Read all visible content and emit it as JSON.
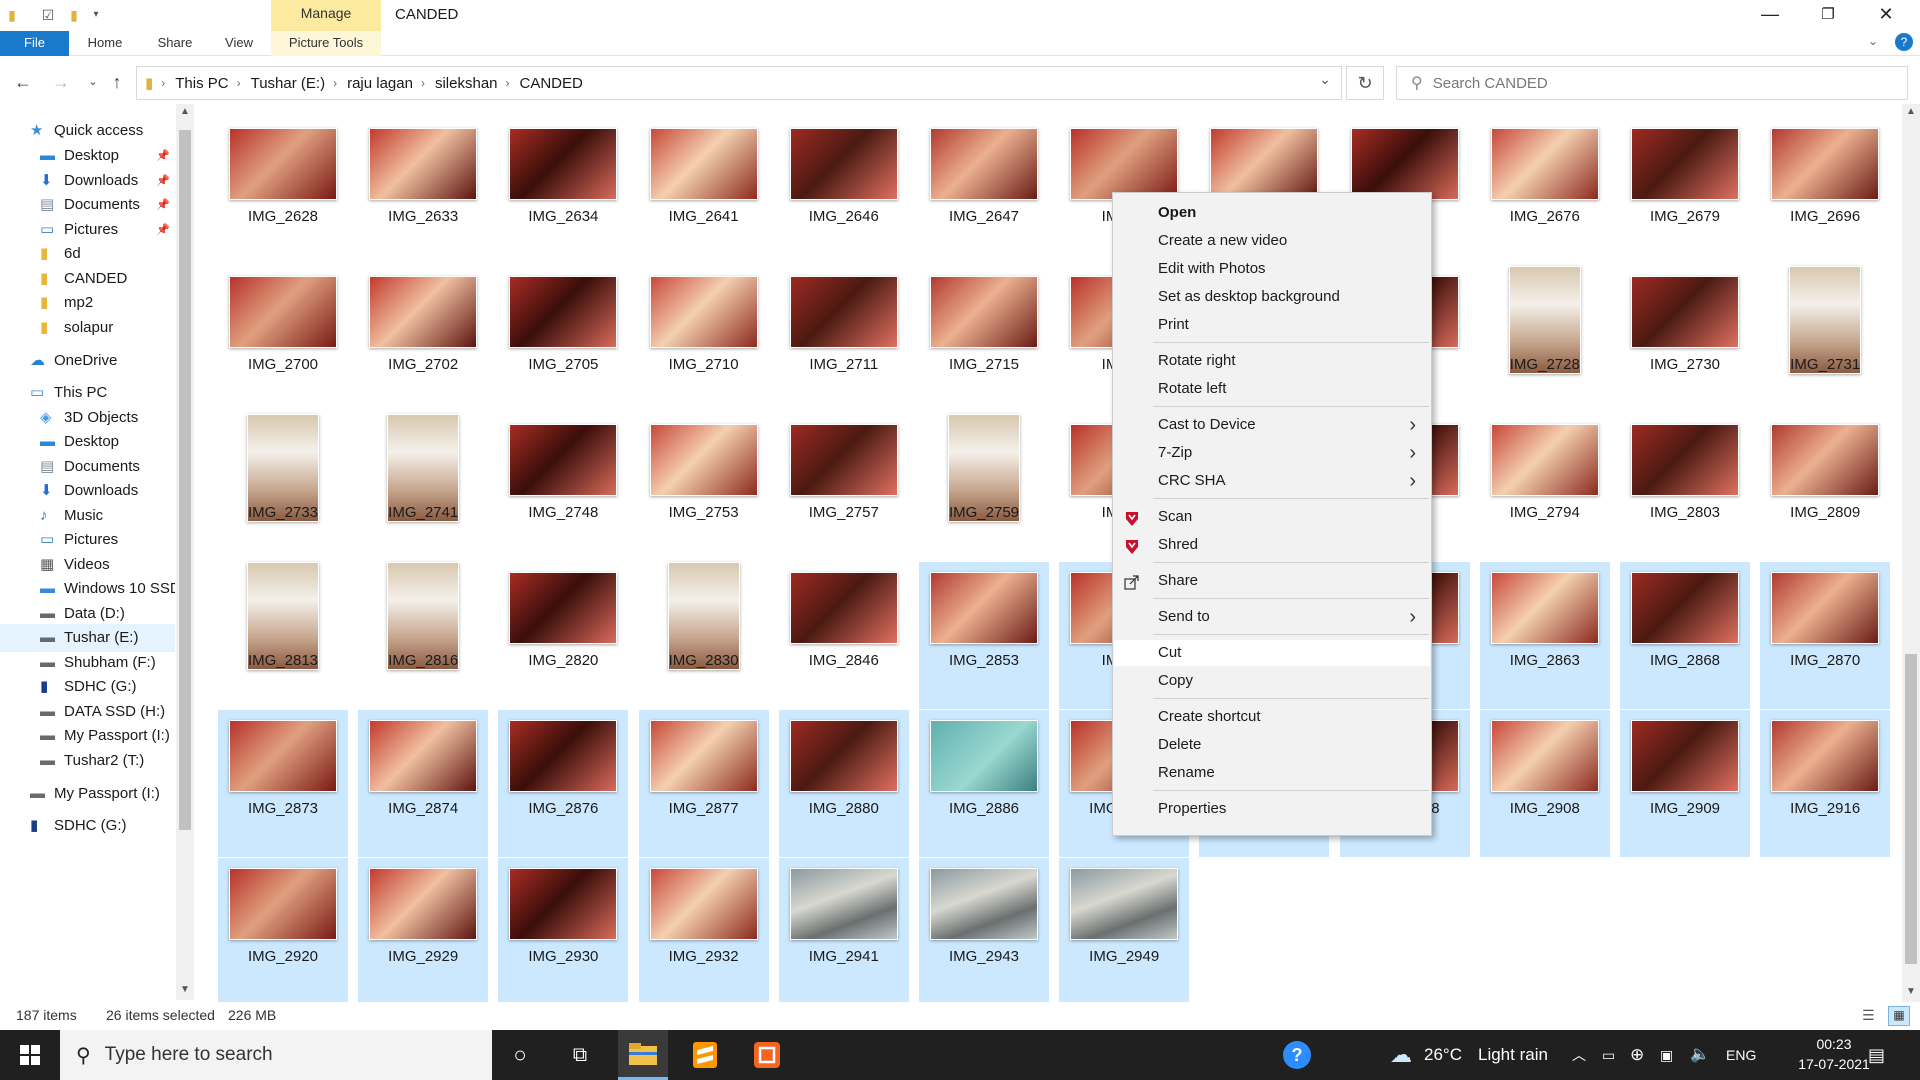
{
  "window": {
    "title": "CANDED",
    "manage_tab": "Manage",
    "colors": {
      "accent": "#1979ca",
      "selection": "#cce8ff",
      "manage_tab": "#fbeaa0",
      "taskbar": "#202020"
    }
  },
  "ribbon": {
    "tabs": [
      "File",
      "Home",
      "Share",
      "View",
      "Picture Tools"
    ]
  },
  "address": {
    "crumbs": [
      "This PC",
      "Tushar (E:)",
      "raju lagan",
      "silekshan",
      "CANDED"
    ],
    "search_placeholder": "Search CANDED"
  },
  "nav": {
    "items": [
      {
        "label": "Quick access",
        "icon": "star-icon",
        "indent": 0
      },
      {
        "label": "Desktop",
        "icon": "desktop-icon",
        "indent": 1,
        "pinned": true
      },
      {
        "label": "Downloads",
        "icon": "download-icon",
        "indent": 1,
        "pinned": true
      },
      {
        "label": "Documents",
        "icon": "documents-icon",
        "indent": 1,
        "pinned": true
      },
      {
        "label": "Pictures",
        "icon": "pictures-icon",
        "indent": 1,
        "pinned": true
      },
      {
        "label": "6d",
        "icon": "folder-icon",
        "indent": 1
      },
      {
        "label": "CANDED",
        "icon": "folder-icon",
        "indent": 1
      },
      {
        "label": "mp2",
        "icon": "folder-icon",
        "indent": 1
      },
      {
        "label": "solapur",
        "icon": "folder-icon",
        "indent": 1
      },
      {
        "label": "OneDrive",
        "icon": "cloud-icon",
        "indent": 0
      },
      {
        "label": "This PC",
        "icon": "pc-icon",
        "indent": 0
      },
      {
        "label": "3D Objects",
        "icon": "cube-icon",
        "indent": 1
      },
      {
        "label": "Desktop",
        "icon": "desktop-icon",
        "indent": 1
      },
      {
        "label": "Documents",
        "icon": "documents-icon",
        "indent": 1
      },
      {
        "label": "Downloads",
        "icon": "download-icon",
        "indent": 1
      },
      {
        "label": "Music",
        "icon": "music-icon",
        "indent": 1
      },
      {
        "label": "Pictures",
        "icon": "pictures-icon",
        "indent": 1
      },
      {
        "label": "Videos",
        "icon": "videos-icon",
        "indent": 1
      },
      {
        "label": "Windows 10 SSD",
        "icon": "windows-drive-icon",
        "indent": 1
      },
      {
        "label": "Data (D:)",
        "icon": "drive-icon",
        "indent": 1
      },
      {
        "label": "Tushar (E:)",
        "icon": "drive-icon",
        "indent": 1,
        "selected": true
      },
      {
        "label": "Shubham (F:)",
        "icon": "drive-icon",
        "indent": 1
      },
      {
        "label": "SDHC (G:)",
        "icon": "sd-card-icon",
        "indent": 1
      },
      {
        "label": "DATA SSD (H:)",
        "icon": "drive-icon",
        "indent": 1
      },
      {
        "label": "My Passport (I:)",
        "icon": "drive-icon",
        "indent": 1
      },
      {
        "label": "Tushar2 (T:)",
        "icon": "drive-icon",
        "indent": 1
      },
      {
        "label": "My Passport (I:)",
        "icon": "drive-icon",
        "indent": 0
      },
      {
        "label": "SDHC (G:)",
        "icon": "sd-card-icon",
        "indent": 0
      }
    ]
  },
  "files": [
    {
      "name": "IMG_2628"
    },
    {
      "name": "IMG_2633"
    },
    {
      "name": "IMG_2634"
    },
    {
      "name": "IMG_2641"
    },
    {
      "name": "IMG_2646"
    },
    {
      "name": "IMG_2647"
    },
    {
      "name": "IMG_2"
    },
    {
      "name": ""
    },
    {
      "name": "5"
    },
    {
      "name": "IMG_2676"
    },
    {
      "name": "IMG_2679"
    },
    {
      "name": "IMG_2696"
    },
    {
      "name": "IMG_2700"
    },
    {
      "name": "IMG_2702"
    },
    {
      "name": "IMG_2705"
    },
    {
      "name": "IMG_2710"
    },
    {
      "name": "IMG_2711"
    },
    {
      "name": "IMG_2715"
    },
    {
      "name": "IMG_2"
    },
    {
      "name": ""
    },
    {
      "name": "5"
    },
    {
      "name": "IMG_2728",
      "portrait": true
    },
    {
      "name": "IMG_2730"
    },
    {
      "name": "IMG_2731",
      "portrait": true
    },
    {
      "name": "IMG_2733",
      "portrait": true
    },
    {
      "name": "IMG_2741",
      "portrait": true
    },
    {
      "name": "IMG_2748"
    },
    {
      "name": "IMG_2753"
    },
    {
      "name": "IMG_2757"
    },
    {
      "name": "IMG_2759",
      "portrait": true
    },
    {
      "name": "IMG_2"
    },
    {
      "name": ""
    },
    {
      "name": "3"
    },
    {
      "name": "IMG_2794"
    },
    {
      "name": "IMG_2803"
    },
    {
      "name": "IMG_2809"
    },
    {
      "name": "IMG_2813",
      "portrait": true
    },
    {
      "name": "IMG_2816",
      "portrait": true
    },
    {
      "name": "IMG_2820"
    },
    {
      "name": "IMG_2830",
      "portrait": true
    },
    {
      "name": "IMG_2846"
    },
    {
      "name": "IMG_2853",
      "selected": true
    },
    {
      "name": "IMG_2",
      "selected": true
    },
    {
      "name": "",
      "selected": true
    },
    {
      "name": "1",
      "selected": true
    },
    {
      "name": "IMG_2863",
      "selected": true
    },
    {
      "name": "IMG_2868",
      "selected": true
    },
    {
      "name": "IMG_2870",
      "selected": true
    },
    {
      "name": "IMG_2873",
      "selected": true
    },
    {
      "name": "IMG_2874",
      "selected": true
    },
    {
      "name": "IMG_2876",
      "selected": true
    },
    {
      "name": "IMG_2877",
      "selected": true
    },
    {
      "name": "IMG_2880",
      "selected": true
    },
    {
      "name": "IMG_2886",
      "selected": true
    },
    {
      "name": "IMG_2892",
      "selected": true
    },
    {
      "name": "IMG_2895",
      "selected": true
    },
    {
      "name": "IMG_2898",
      "selected": true
    },
    {
      "name": "IMG_2908",
      "selected": true
    },
    {
      "name": "IMG_2909",
      "selected": true
    },
    {
      "name": "IMG_2916",
      "selected": true
    },
    {
      "name": "IMG_2920",
      "selected": true
    },
    {
      "name": "IMG_2929",
      "selected": true
    },
    {
      "name": "IMG_2930",
      "selected": true
    },
    {
      "name": "IMG_2932",
      "selected": true
    },
    {
      "name": "IMG_2941",
      "selected": true
    },
    {
      "name": "IMG_2943",
      "selected": true
    },
    {
      "name": "IMG_2949",
      "selected": true
    }
  ],
  "context_menu": {
    "items": [
      {
        "label": "Open",
        "bold": true
      },
      {
        "label": "Create a new video"
      },
      {
        "label": "Edit with Photos"
      },
      {
        "label": "Set as desktop background"
      },
      {
        "label": "Print"
      },
      {
        "sep": true
      },
      {
        "label": "Rotate right"
      },
      {
        "label": "Rotate left"
      },
      {
        "sep": true
      },
      {
        "label": "Cast to Device",
        "submenu": true
      },
      {
        "label": "7-Zip",
        "submenu": true
      },
      {
        "label": "CRC SHA",
        "submenu": true
      },
      {
        "sep": true
      },
      {
        "label": "Scan",
        "icon": "mcafee-icon"
      },
      {
        "label": "Shred",
        "icon": "mcafee-icon"
      },
      {
        "sep": true
      },
      {
        "label": "Share",
        "icon": "share-icon"
      },
      {
        "sep": true
      },
      {
        "label": "Send to",
        "submenu": true
      },
      {
        "sep": true
      },
      {
        "label": "Cut",
        "hover": true
      },
      {
        "label": "Copy"
      },
      {
        "sep": true
      },
      {
        "label": "Create shortcut"
      },
      {
        "label": "Delete"
      },
      {
        "label": "Rename"
      },
      {
        "sep": true
      },
      {
        "label": "Properties"
      }
    ]
  },
  "status": {
    "count": "187 items",
    "selected": "26 items selected",
    "size": "226 MB"
  },
  "taskbar": {
    "search_placeholder": "Type here to search",
    "weather_temp": "26°C",
    "weather_text": "Light rain",
    "lang": "ENG",
    "time": "00:23",
    "date": "17-07-2021"
  }
}
